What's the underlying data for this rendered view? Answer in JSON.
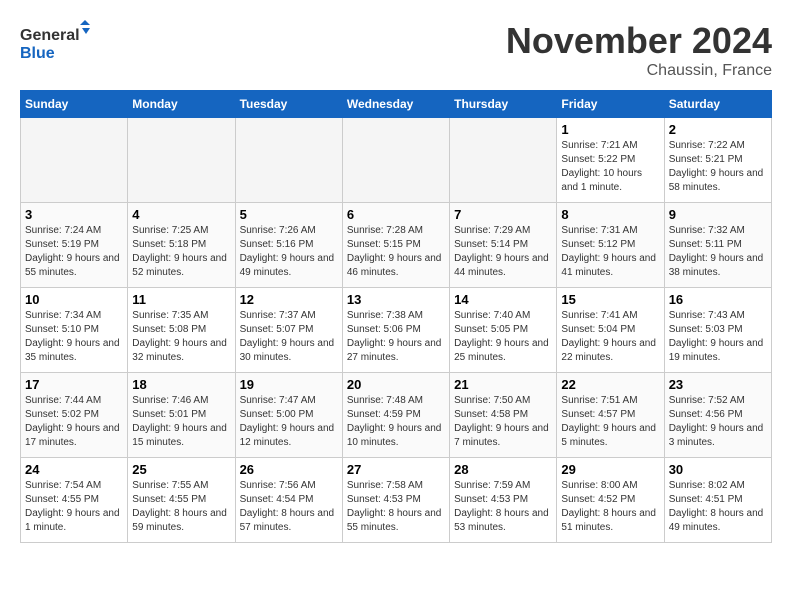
{
  "logo": {
    "general": "General",
    "blue": "Blue"
  },
  "title": "November 2024",
  "location": "Chaussin, France",
  "days_of_week": [
    "Sunday",
    "Monday",
    "Tuesday",
    "Wednesday",
    "Thursday",
    "Friday",
    "Saturday"
  ],
  "weeks": [
    [
      {
        "day": "",
        "info": ""
      },
      {
        "day": "",
        "info": ""
      },
      {
        "day": "",
        "info": ""
      },
      {
        "day": "",
        "info": ""
      },
      {
        "day": "",
        "info": ""
      },
      {
        "day": "1",
        "info": "Sunrise: 7:21 AM\nSunset: 5:22 PM\nDaylight: 10 hours and 1 minute."
      },
      {
        "day": "2",
        "info": "Sunrise: 7:22 AM\nSunset: 5:21 PM\nDaylight: 9 hours and 58 minutes."
      }
    ],
    [
      {
        "day": "3",
        "info": "Sunrise: 7:24 AM\nSunset: 5:19 PM\nDaylight: 9 hours and 55 minutes."
      },
      {
        "day": "4",
        "info": "Sunrise: 7:25 AM\nSunset: 5:18 PM\nDaylight: 9 hours and 52 minutes."
      },
      {
        "day": "5",
        "info": "Sunrise: 7:26 AM\nSunset: 5:16 PM\nDaylight: 9 hours and 49 minutes."
      },
      {
        "day": "6",
        "info": "Sunrise: 7:28 AM\nSunset: 5:15 PM\nDaylight: 9 hours and 46 minutes."
      },
      {
        "day": "7",
        "info": "Sunrise: 7:29 AM\nSunset: 5:14 PM\nDaylight: 9 hours and 44 minutes."
      },
      {
        "day": "8",
        "info": "Sunrise: 7:31 AM\nSunset: 5:12 PM\nDaylight: 9 hours and 41 minutes."
      },
      {
        "day": "9",
        "info": "Sunrise: 7:32 AM\nSunset: 5:11 PM\nDaylight: 9 hours and 38 minutes."
      }
    ],
    [
      {
        "day": "10",
        "info": "Sunrise: 7:34 AM\nSunset: 5:10 PM\nDaylight: 9 hours and 35 minutes."
      },
      {
        "day": "11",
        "info": "Sunrise: 7:35 AM\nSunset: 5:08 PM\nDaylight: 9 hours and 32 minutes."
      },
      {
        "day": "12",
        "info": "Sunrise: 7:37 AM\nSunset: 5:07 PM\nDaylight: 9 hours and 30 minutes."
      },
      {
        "day": "13",
        "info": "Sunrise: 7:38 AM\nSunset: 5:06 PM\nDaylight: 9 hours and 27 minutes."
      },
      {
        "day": "14",
        "info": "Sunrise: 7:40 AM\nSunset: 5:05 PM\nDaylight: 9 hours and 25 minutes."
      },
      {
        "day": "15",
        "info": "Sunrise: 7:41 AM\nSunset: 5:04 PM\nDaylight: 9 hours and 22 minutes."
      },
      {
        "day": "16",
        "info": "Sunrise: 7:43 AM\nSunset: 5:03 PM\nDaylight: 9 hours and 19 minutes."
      }
    ],
    [
      {
        "day": "17",
        "info": "Sunrise: 7:44 AM\nSunset: 5:02 PM\nDaylight: 9 hours and 17 minutes."
      },
      {
        "day": "18",
        "info": "Sunrise: 7:46 AM\nSunset: 5:01 PM\nDaylight: 9 hours and 15 minutes."
      },
      {
        "day": "19",
        "info": "Sunrise: 7:47 AM\nSunset: 5:00 PM\nDaylight: 9 hours and 12 minutes."
      },
      {
        "day": "20",
        "info": "Sunrise: 7:48 AM\nSunset: 4:59 PM\nDaylight: 9 hours and 10 minutes."
      },
      {
        "day": "21",
        "info": "Sunrise: 7:50 AM\nSunset: 4:58 PM\nDaylight: 9 hours and 7 minutes."
      },
      {
        "day": "22",
        "info": "Sunrise: 7:51 AM\nSunset: 4:57 PM\nDaylight: 9 hours and 5 minutes."
      },
      {
        "day": "23",
        "info": "Sunrise: 7:52 AM\nSunset: 4:56 PM\nDaylight: 9 hours and 3 minutes."
      }
    ],
    [
      {
        "day": "24",
        "info": "Sunrise: 7:54 AM\nSunset: 4:55 PM\nDaylight: 9 hours and 1 minute."
      },
      {
        "day": "25",
        "info": "Sunrise: 7:55 AM\nSunset: 4:55 PM\nDaylight: 8 hours and 59 minutes."
      },
      {
        "day": "26",
        "info": "Sunrise: 7:56 AM\nSunset: 4:54 PM\nDaylight: 8 hours and 57 minutes."
      },
      {
        "day": "27",
        "info": "Sunrise: 7:58 AM\nSunset: 4:53 PM\nDaylight: 8 hours and 55 minutes."
      },
      {
        "day": "28",
        "info": "Sunrise: 7:59 AM\nSunset: 4:53 PM\nDaylight: 8 hours and 53 minutes."
      },
      {
        "day": "29",
        "info": "Sunrise: 8:00 AM\nSunset: 4:52 PM\nDaylight: 8 hours and 51 minutes."
      },
      {
        "day": "30",
        "info": "Sunrise: 8:02 AM\nSunset: 4:51 PM\nDaylight: 8 hours and 49 minutes."
      }
    ]
  ]
}
